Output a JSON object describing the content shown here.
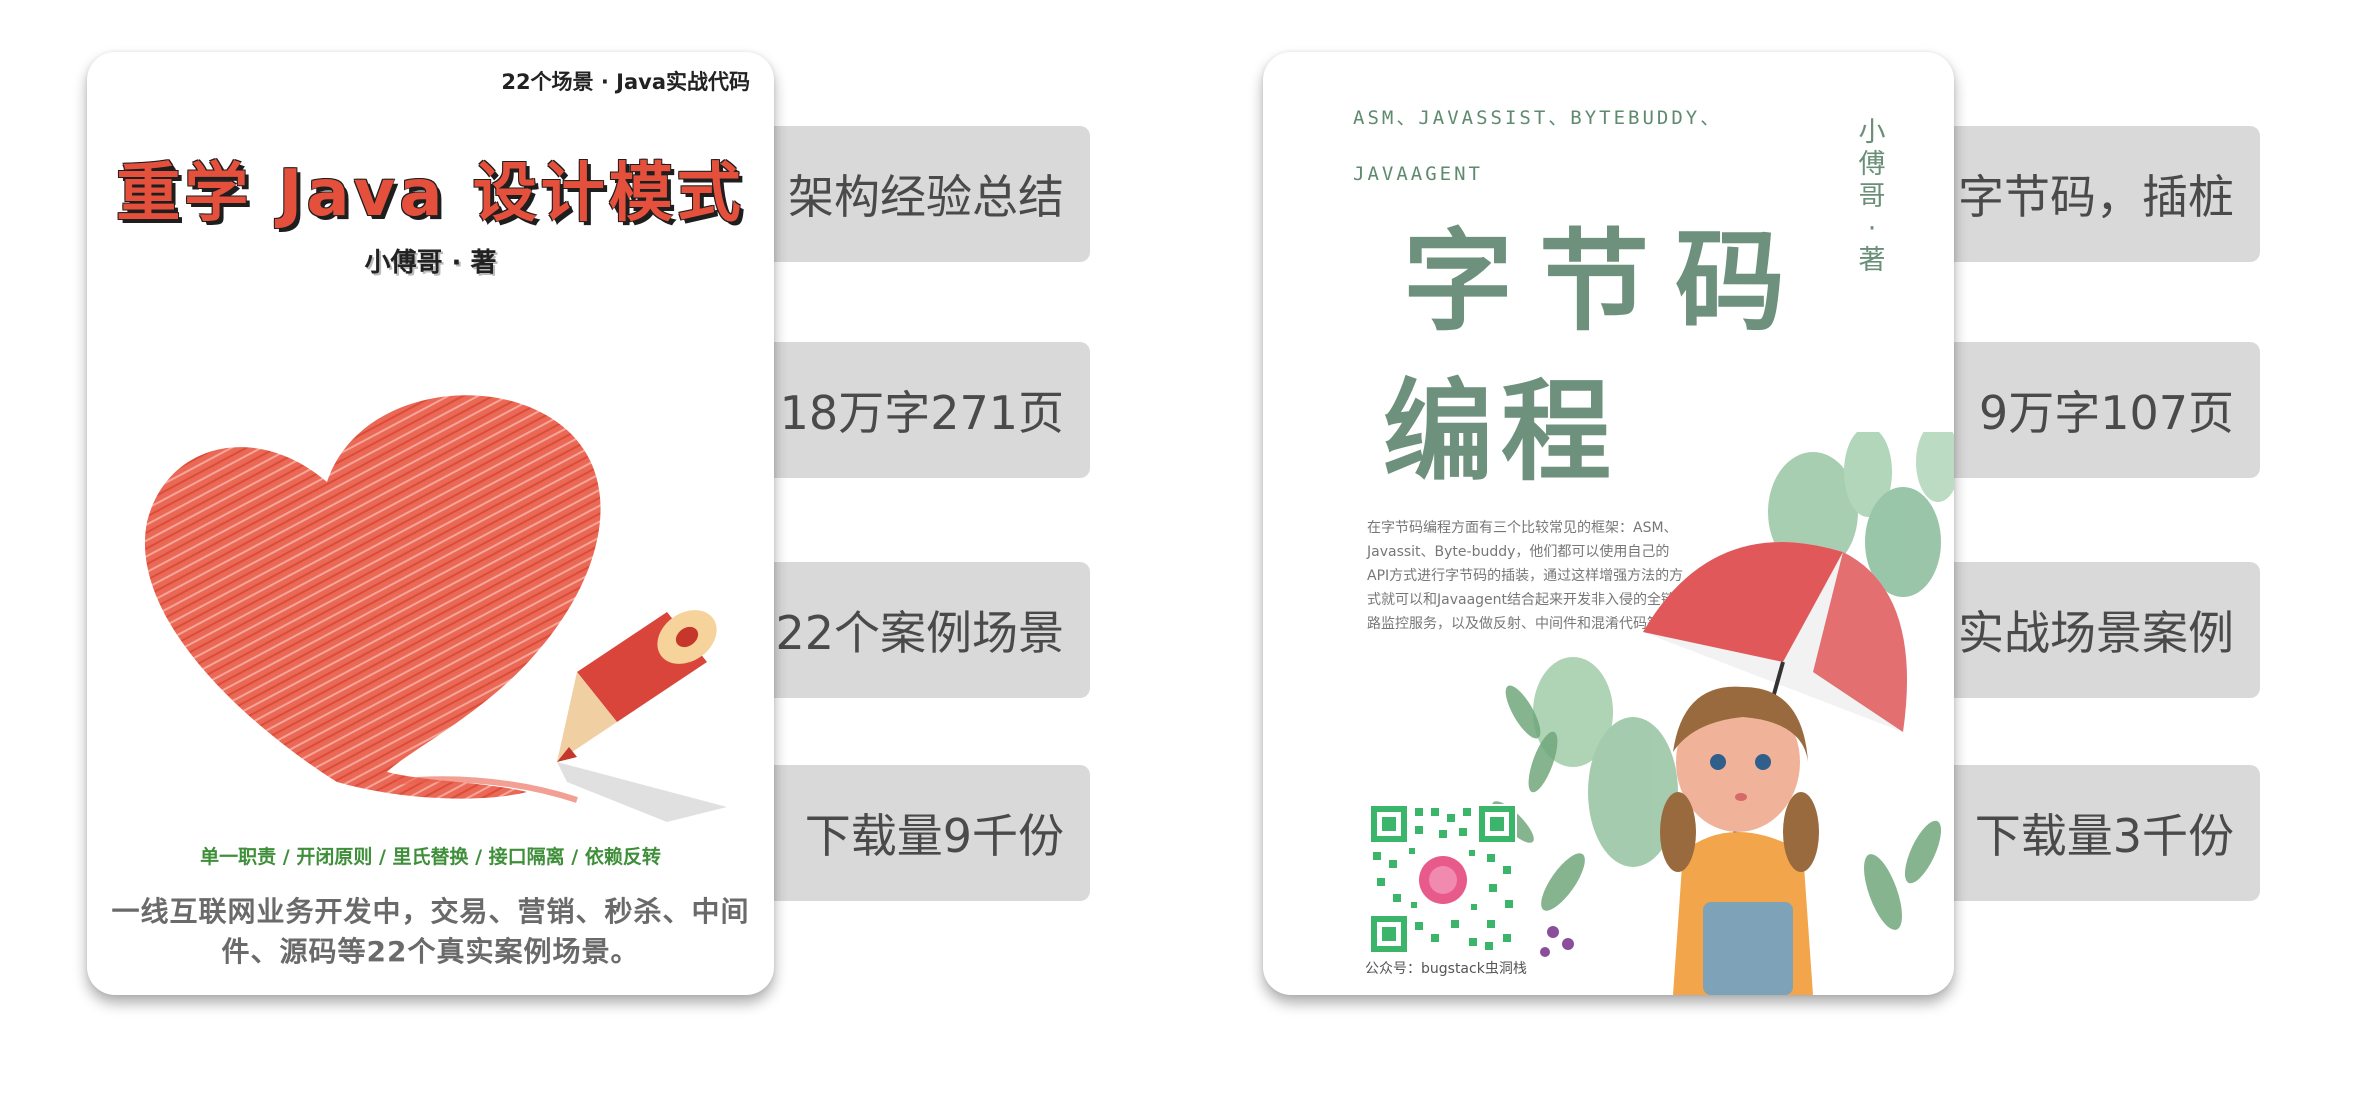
{
  "book1": {
    "top_line": "22个场景 · Java实战代码",
    "title": "重学 Java 设计模式",
    "author": "小傅哥 · 著",
    "principles": "单一职责 / 开闭原则 / 里氏替换 / 接口隔离 / 依赖反转",
    "description": "一线互联网业务开发中，交易、营销、秒杀、中间件、源码等22个真实案例场景。",
    "tags": [
      "架构经验总结",
      "18万字271页",
      "22个案例场景",
      "下载量9千份"
    ]
  },
  "book2": {
    "tech_list": "ASM、JAVASSIST、BYTEBUDDY、JAVAAGENT",
    "author": "小傅哥 · 著",
    "title_line1": "字节码",
    "title_line2": "编程",
    "description": "在字节码编程方面有三个比较常见的框架：ASM、Javassit、Byte-buddy，他们都可以使用自己的API方式进行字节码的插装，通过这样增强方法的方式就可以和Javaagent结合起来开发非入侵的全链路监控服务，以及做反射、中间件和混淆代码等。",
    "qr_label": "公众号：bugstack虫洞栈",
    "tags": [
      "字节码，插桩",
      "9万字107页",
      "实战场景案例",
      "下载量3千份"
    ]
  },
  "colors": {
    "tag_bg": "#d9d9d9",
    "tag_text": "#4a4a4a",
    "book1_title": "#e4503c",
    "book1_principles": "#3f8f3a",
    "book2_title": "#6d917c",
    "heart": "#e4503c",
    "qr_green": "#3bb56a",
    "umbrella": "#e0585a"
  },
  "icons": {
    "heart": "crayon-heart-icon",
    "pencil": "red-pencil-icon",
    "qr": "qr-code-icon",
    "girl": "girl-with-umbrella-illustration",
    "cactus": "cactus-illustration"
  }
}
